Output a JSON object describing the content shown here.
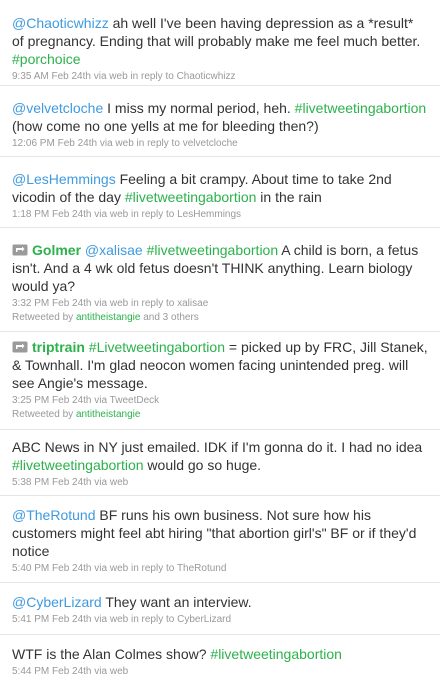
{
  "colors": {
    "mention": "#3f9ae0",
    "hashtag": "#2bb24c",
    "text": "#333333",
    "meta": "#999999",
    "divider": "#e6e6e6"
  },
  "tweets": [
    {
      "mention": "@Chaoticwhizz",
      "text_1": " ah well I've been having depression as a *result* of pregnancy. Ending that will probably make me feel much better. ",
      "hashtag": "#porchoice",
      "time": "9:35 AM Feb 24th",
      "via": " via ",
      "source": "web",
      "reply_prefix": " in reply to ",
      "reply_to": "Chaoticwhizz"
    },
    {
      "mention": "@velvetcloche",
      "text_1": " I miss my normal period, heh. ",
      "hashtag": "#livetweetingabortion",
      "text_2": " (how come no one yells at me for bleeding then?)",
      "time": "12:06 PM Feb 24th",
      "via": " via ",
      "source": "web",
      "reply_prefix": " in reply to ",
      "reply_to": "velvetcloche"
    },
    {
      "mention": "@LesHemmings",
      "text_1": " Feeling a bit crampy. About time to take 2nd vicodin of the day ",
      "hashtag": "#livetweetingabortion",
      "text_2": " in the rain",
      "time": "1:18 PM Feb 24th",
      "via": " via ",
      "source": "web",
      "reply_prefix": " in reply to ",
      "reply_to": "LesHemmings"
    },
    {
      "retweet_icon": "retweet-icon",
      "user": "Golmer",
      "mention": "@xalisae",
      "hashtag": "#livetweetingabortion",
      "text_1": " A child is born, a fetus isn't. And a 4 wk old fetus doesn't THINK anything. Learn biology would ya?",
      "time": "3:32 PM Feb 24th",
      "via": " via ",
      "source": "web",
      "reply_prefix": " in reply to ",
      "reply_to": "xalisae",
      "retweeted_prefix": "Retweeted by ",
      "retweeted_by": "antitheistangie",
      "retweeted_suffix": " and 3 others"
    },
    {
      "retweet_icon": "retweet-icon",
      "user": "triptrain",
      "hashtag": "#Livetweetingabortion",
      "text_1": " = picked up by FRC, Jill Stanek, & Townhall. I'm glad neocon women facing unintended preg. will see Angie's message.",
      "time": "3:25 PM Feb 24th",
      "via": " via ",
      "source": "TweetDeck",
      "retweeted_prefix": "Retweeted by ",
      "retweeted_by": "antitheistangie"
    },
    {
      "text_1": "ABC News in NY just emailed. IDK if I'm gonna do it. I had no idea ",
      "hashtag": "#livetweetingabortion",
      "text_2": " would go so huge.",
      "time": "5:38 PM Feb 24th",
      "via": " via ",
      "source": "web"
    },
    {
      "mention": "@TheRotund",
      "text_1": " BF runs his own business. Not sure how his customers might feel abt hiring \"that abortion girl's\" BF or if they'd notice",
      "time": "5:40 PM Feb 24th",
      "via": " via ",
      "source": "web",
      "reply_prefix": " in reply to ",
      "reply_to": "TheRotund"
    },
    {
      "mention": "@CyberLizard",
      "text_1": " They want an interview.",
      "time": "5:41 PM Feb 24th",
      "via": " via ",
      "source": "web",
      "reply_prefix": " in reply to ",
      "reply_to": "CyberLizard"
    },
    {
      "text_1": "WTF is the Alan Colmes show? ",
      "hashtag": "#livetweetingabortion",
      "time": "5:44 PM Feb 24th",
      "via": " via ",
      "source": "web"
    }
  ]
}
